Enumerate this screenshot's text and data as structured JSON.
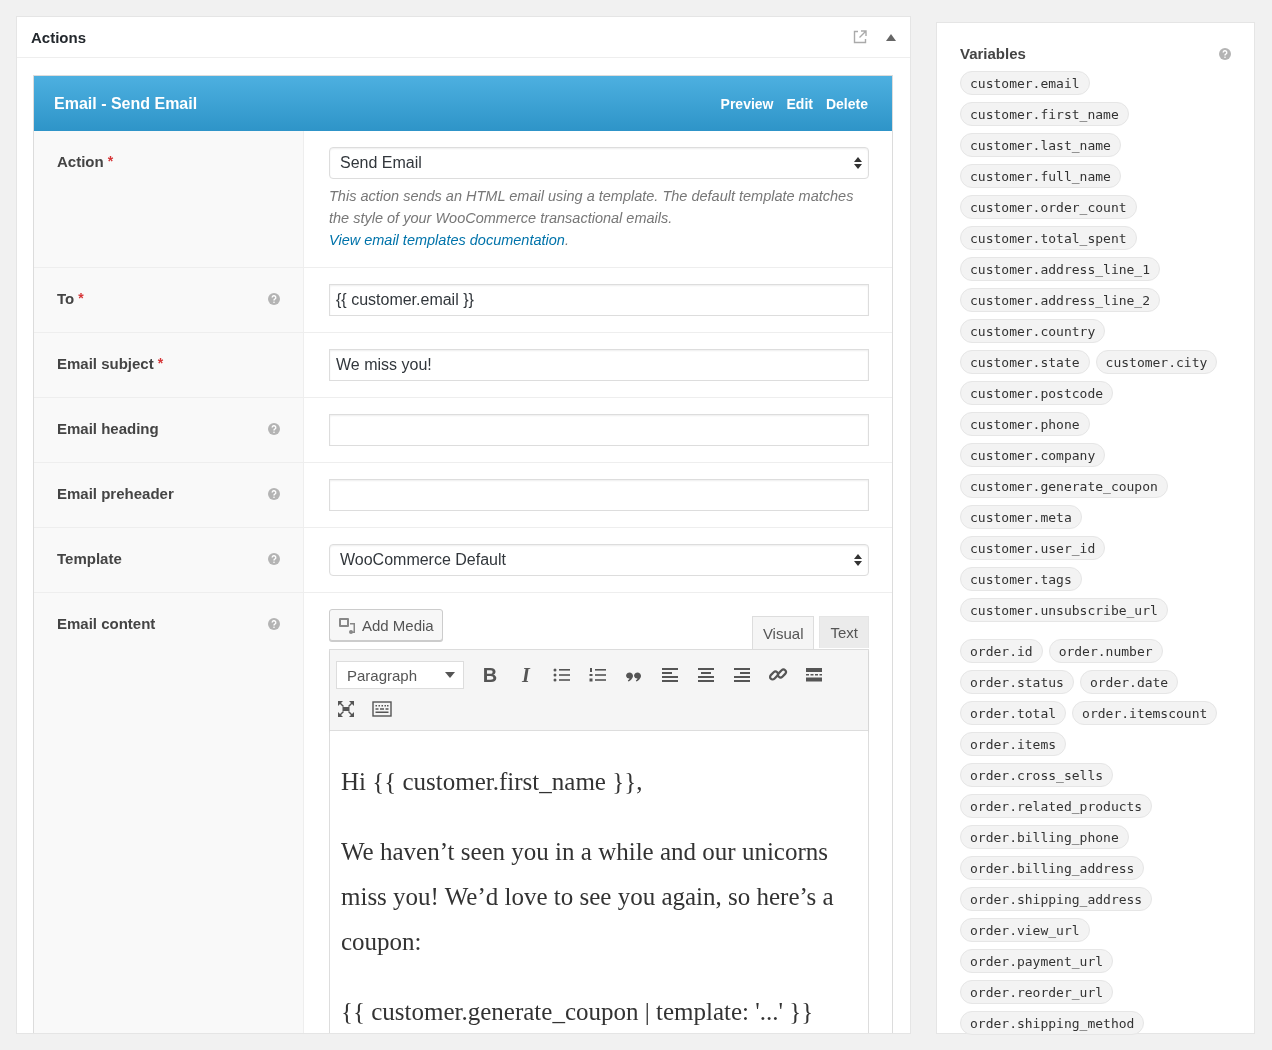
{
  "actions_panel": {
    "title": "Actions",
    "expanded": true
  },
  "action": {
    "title": "Email - Send Email",
    "links": [
      "Preview",
      "Edit",
      "Delete"
    ]
  },
  "fields": [
    {
      "kind": "select",
      "label": "Action",
      "required_mark": "*",
      "help": false,
      "value": "Send Email",
      "description": "This action sends an HTML email using a template. The default template matches the style of your WooCommerce transactional emails. ",
      "description_link": "View email templates documentation",
      "description_end": "."
    },
    {
      "kind": "text",
      "label": "To",
      "required_mark": "*",
      "help": true,
      "value": "{{ customer.email }}"
    },
    {
      "kind": "text",
      "label": "Email subject",
      "required_mark": "*",
      "help": false,
      "value": "We miss you!"
    },
    {
      "kind": "text",
      "label": "Email heading",
      "help": true
    },
    {
      "kind": "text",
      "label": "Email preheader",
      "help": true
    },
    {
      "kind": "select",
      "label": "Template",
      "help": true,
      "value": "WooCommerce Default"
    },
    {
      "kind": "editor",
      "label": "Email content",
      "help": true
    }
  ],
  "editor": {
    "add_media": "Add Media",
    "tabs": [
      {
        "label": "Visual",
        "selected": true
      },
      {
        "label": "Text",
        "selected": false
      }
    ],
    "format": "Paragraph",
    "toolbar_rows": [
      [
        {
          "kind": "bold",
          "glyph": "B"
        },
        {
          "kind": "italic",
          "glyph": "I"
        },
        {
          "kind": "bullet-list"
        },
        {
          "kind": "numbered-list"
        },
        {
          "kind": "blockquote"
        },
        {
          "kind": "align-left"
        },
        {
          "kind": "align-center"
        },
        {
          "kind": "align-right"
        },
        {
          "kind": "link"
        },
        {
          "kind": "read-more"
        }
      ],
      [
        {
          "kind": "fullscreen"
        },
        {
          "kind": "toolbar-toggle"
        }
      ]
    ],
    "paragraphs": [
      "Hi {{ customer.first_name }},",
      "We haven’t seen you in a while and our unicorns miss you! We’d love to see you again, so here’s a coupon:",
      "{{ customer.generate_coupon | template: '...' }}"
    ]
  },
  "variables": {
    "title": "Variables",
    "groups": [
      [
        "customer.email",
        "customer.first_name",
        "customer.last_name",
        "customer.full_name",
        "customer.order_count",
        "customer.total_spent",
        "customer.address_line_1",
        "customer.address_line_2",
        "customer.country",
        "customer.state",
        "customer.city",
        "customer.postcode",
        "customer.phone",
        "customer.company",
        "customer.generate_coupon",
        "customer.meta",
        "customer.user_id",
        "customer.tags",
        "customer.unsubscribe_url"
      ],
      [
        "order.id",
        "order.number",
        "order.status",
        "order.date",
        "order.total",
        "order.itemscount",
        "order.items",
        "order.cross_sells",
        "order.related_products",
        "order.billing_phone",
        "order.billing_address",
        "order.shipping_address",
        "order.view_url",
        "order.payment_url",
        "order.reorder_url",
        "order.shipping_method"
      ]
    ]
  }
}
